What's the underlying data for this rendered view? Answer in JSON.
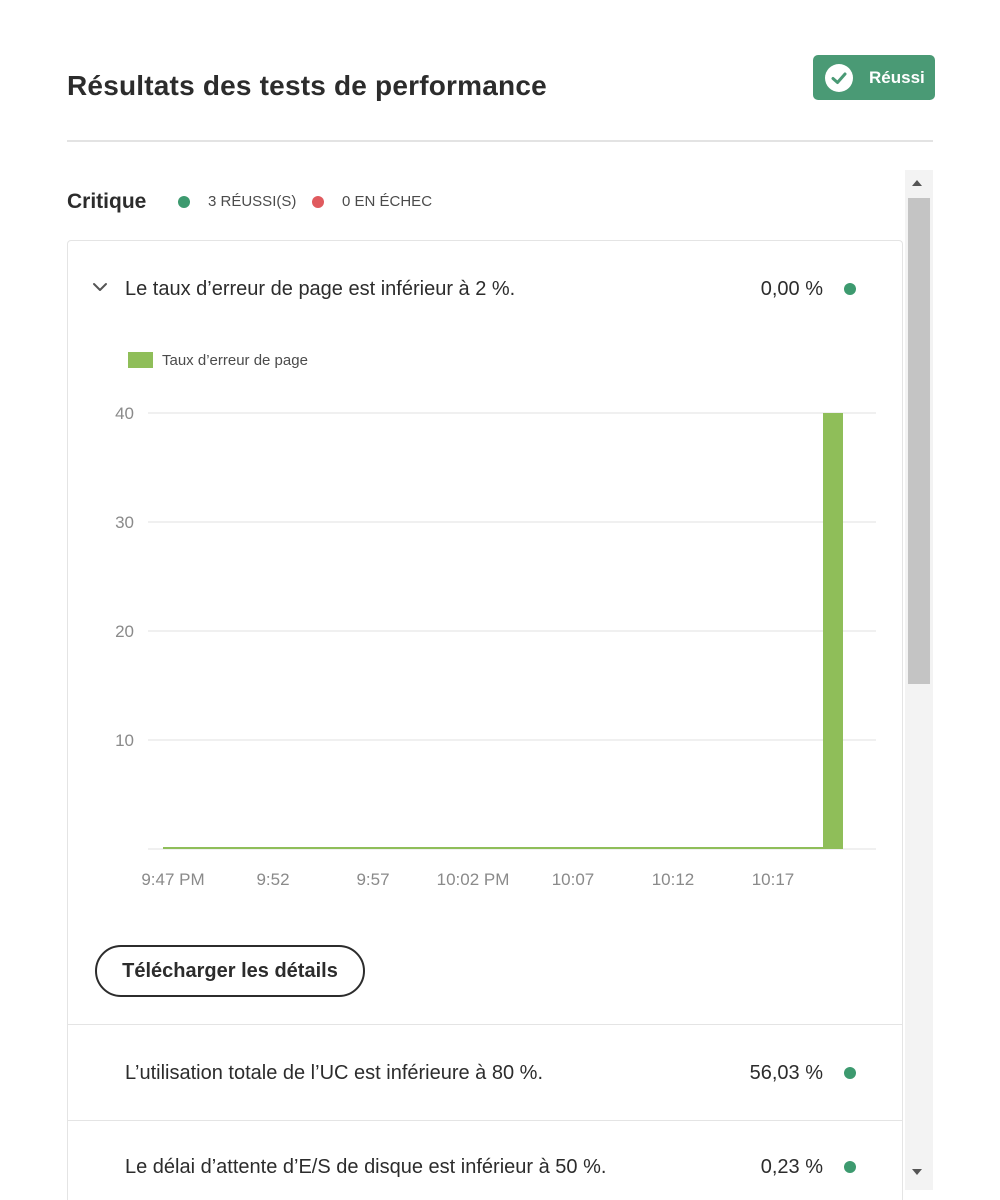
{
  "header": {
    "title": "Résultats des tests de performance",
    "status_badge": "Réussi"
  },
  "critical": {
    "label": "Critique",
    "passed": "3 RÉUSSI(S)",
    "failed": "0 EN ÉCHEC"
  },
  "tests": [
    {
      "label": "Le taux d’erreur de page est inférieur à 2 %.",
      "value": "0,00 %",
      "status": "pass",
      "expanded": true
    },
    {
      "label": "L’utilisation totale de l’UC est inférieure à 80 %.",
      "value": "56,03 %",
      "status": "pass",
      "expanded": false
    },
    {
      "label": "Le délai d’attente d’E/S de disque est inférieur à 50 %.",
      "value": "0,23 %",
      "status": "pass",
      "expanded": false
    }
  ],
  "download_button": "Télécharger les détails",
  "colors": {
    "pass": "#3d9a6f",
    "fail": "#e05a5e",
    "badge": "#4a9a75",
    "bar": "#8fbe59"
  },
  "chart_data": {
    "type": "bar",
    "legend": [
      "Taux d’erreur de page"
    ],
    "x_tick_labels": [
      "9:47 PM",
      "9:52",
      "9:57",
      "10:02 PM",
      "10:07",
      "10:12",
      "10:17"
    ],
    "y_ticks": [
      10,
      20,
      30,
      40
    ],
    "ylim": [
      0,
      40
    ],
    "xlim_minutes_after_947pm": [
      0,
      34
    ],
    "series": [
      {
        "name": "Taux d’erreur de page",
        "x_minutes_after_947pm": [
          0,
          1,
          2,
          3,
          4,
          5,
          6,
          7,
          8,
          9,
          10,
          11,
          12,
          13,
          14,
          15,
          16,
          17,
          18,
          19,
          20,
          21,
          22,
          23,
          24,
          25,
          26,
          27,
          28,
          29,
          30,
          31,
          32,
          33
        ],
        "values": [
          0,
          0,
          0,
          0,
          0,
          0,
          0,
          0,
          0,
          0,
          0,
          0,
          0,
          0,
          0,
          0,
          0,
          0,
          0,
          0,
          0,
          0,
          0,
          0,
          0,
          0,
          0,
          0,
          0,
          0,
          0,
          0,
          0,
          40
        ]
      }
    ],
    "grid": true
  }
}
